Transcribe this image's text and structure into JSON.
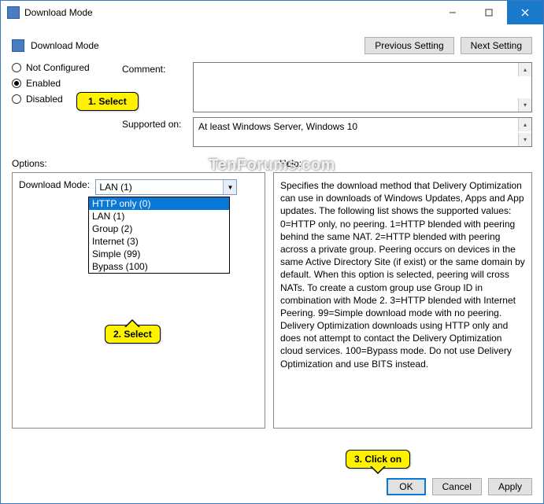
{
  "titlebar": {
    "title": "Download Mode"
  },
  "header": {
    "title": "Download Mode",
    "prev_btn": "Previous Setting",
    "next_btn": "Next Setting"
  },
  "radios": {
    "not_configured": "Not Configured",
    "enabled": "Enabled",
    "disabled": "Disabled"
  },
  "labels": {
    "comment": "Comment:",
    "supported_on": "Supported on:",
    "options": "Options:",
    "help": "Help:",
    "download_mode": "Download Mode:"
  },
  "supported_text": "At least Windows Server, Windows 10",
  "watermark": "TenForums.com",
  "combo": {
    "selected": "LAN (1)",
    "options": [
      "HTTP only (0)",
      "LAN (1)",
      "Group (2)",
      "Internet (3)",
      "Simple (99)",
      "Bypass (100)"
    ],
    "highlighted_index": 0
  },
  "help_text": "Specifies the download method that Delivery Optimization can use in downloads of Windows Updates, Apps and App updates. The following list shows the supported values: 0=HTTP only, no peering. 1=HTTP blended with peering behind the same NAT. 2=HTTP blended with peering across a private group. Peering occurs on devices in the same Active Directory Site (if exist) or the same domain by default. When this option is selected, peering will cross NATs. To create a custom group use Group ID in combination with Mode 2. 3=HTTP blended with Internet Peering. 99=Simple download mode with no peering. Delivery Optimization downloads using HTTP only and does not attempt to contact the Delivery Optimization cloud services. 100=Bypass mode. Do not use Delivery Optimization and use BITS instead.",
  "footer": {
    "ok": "OK",
    "cancel": "Cancel",
    "apply": "Apply"
  },
  "callouts": {
    "c1": "1. Select",
    "c2": "2. Select",
    "c3": "3. Click on"
  }
}
